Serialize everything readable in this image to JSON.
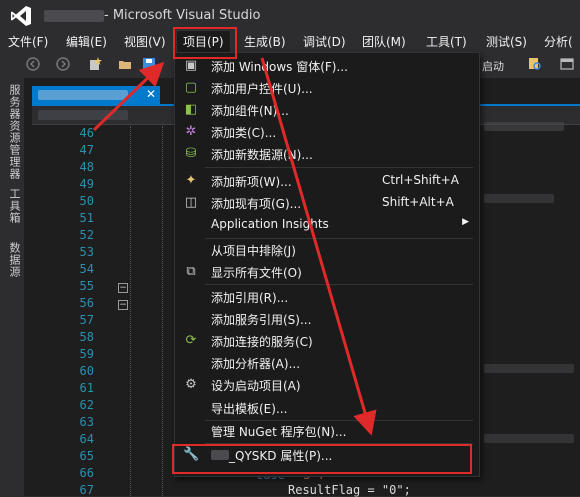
{
  "window": {
    "title": "- Microsoft Visual Studio"
  },
  "menubar": {
    "items": [
      {
        "label": "文件(F)"
      },
      {
        "label": "编辑(E)"
      },
      {
        "label": "视图(V)"
      },
      {
        "label": "项目(P)"
      },
      {
        "label": "生成(B)"
      },
      {
        "label": "调试(D)"
      },
      {
        "label": "团队(M)"
      },
      {
        "label": "工具(T)"
      },
      {
        "label": "测试(S)"
      },
      {
        "label": "分析("
      }
    ]
  },
  "toolbar": {
    "start_label": "启动"
  },
  "side_tabs": [
    {
      "label": "服务器资源管理器"
    },
    {
      "label": "工具箱"
    },
    {
      "label": "数据源"
    }
  ],
  "editor": {
    "line_numbers": [
      "46",
      "47",
      "48",
      "49",
      "50",
      "51",
      "52",
      "53",
      "54",
      "55",
      "56",
      "57",
      "58",
      "59",
      "60",
      "61",
      "62",
      "63",
      "64",
      "65",
      "66",
      "67"
    ],
    "fragments": {
      "case_keyword": "case",
      "case_value": "\"3\":",
      "result_line": "ResultFlag = \"0\";"
    }
  },
  "project_menu": {
    "items": [
      {
        "label": "添加 Windows 窗体(F)...",
        "icon": "windows-form-icon"
      },
      {
        "label": "添加用户控件(U)...",
        "icon": "user-control-icon"
      },
      {
        "label": "添加组件(N)...",
        "icon": "component-icon"
      },
      {
        "label": "添加类(C)...",
        "icon": "class-icon"
      },
      {
        "label": "添加新数据源(N)...",
        "icon": "data-source-icon"
      },
      {
        "label": "添加新项(W)...",
        "shortcut": "Ctrl+Shift+A",
        "icon": "new-item-icon"
      },
      {
        "label": "添加现有项(G)...",
        "shortcut": "Shift+Alt+A",
        "icon": "existing-item-icon"
      },
      {
        "label": "Application Insights",
        "submenu": true
      },
      {
        "label": "从项目中排除(J)"
      },
      {
        "label": "显示所有文件(O)",
        "icon": "show-all-files-icon"
      },
      {
        "label": "添加引用(R)..."
      },
      {
        "label": "添加服务引用(S)..."
      },
      {
        "label": "添加连接的服务(C)",
        "icon": "connected-service-icon"
      },
      {
        "label": "添加分析器(A)..."
      },
      {
        "label": "设为启动项目(A)",
        "icon": "gear-icon"
      },
      {
        "label": "导出模板(E)..."
      },
      {
        "label": "管理 NuGet 程序包(N)..."
      },
      {
        "label": "_QYSKD 属性(P)...",
        "icon": "wrench-icon"
      }
    ]
  },
  "colors": {
    "accent": "#007acc",
    "annotation": "#e02a2a",
    "menu_bg": "#1b1b1c",
    "line_number": "#2b91af"
  }
}
